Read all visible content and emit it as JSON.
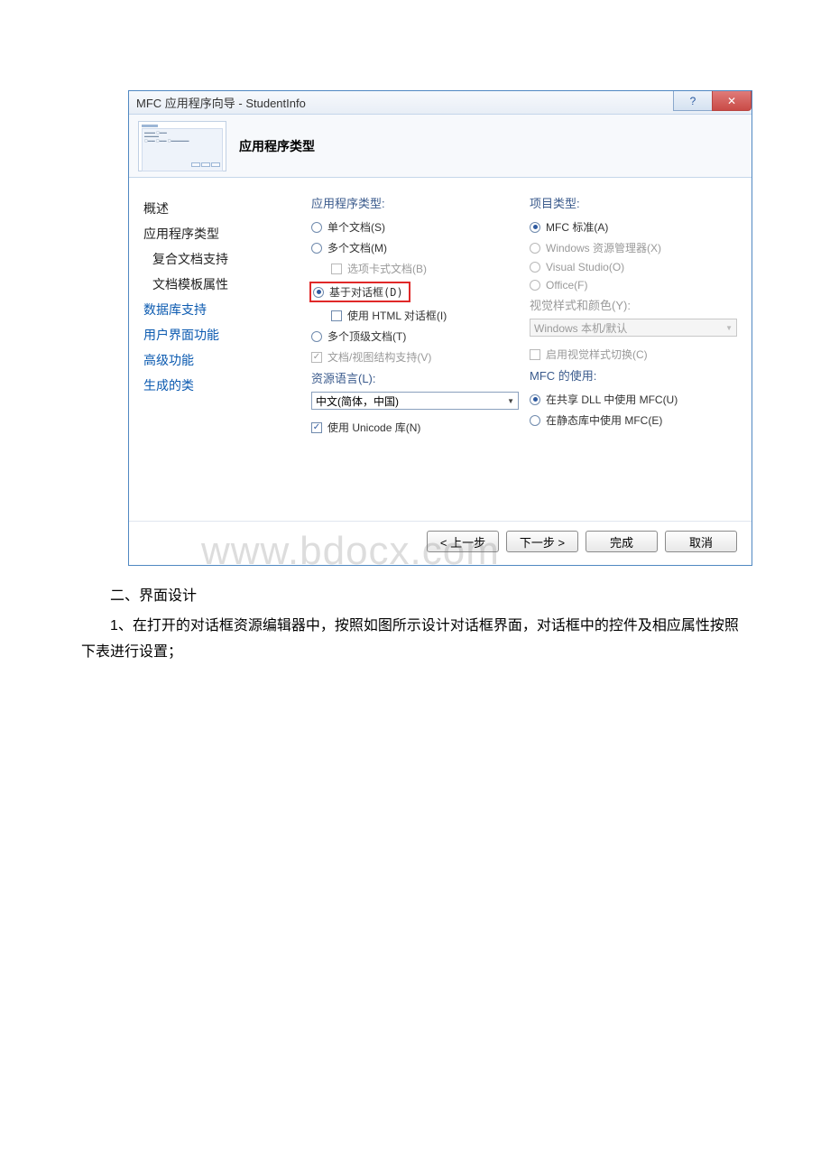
{
  "window": {
    "title": "MFC 应用程序向导 - StudentInfo",
    "help_icon": "?",
    "close_icon": "✕"
  },
  "header": {
    "title": "应用程序类型"
  },
  "sidebar": {
    "items": [
      {
        "label": "概述",
        "link": false,
        "indent": false
      },
      {
        "label": "应用程序类型",
        "link": false,
        "indent": false
      },
      {
        "label": "复合文档支持",
        "link": false,
        "indent": true
      },
      {
        "label": "文档模板属性",
        "link": false,
        "indent": true
      },
      {
        "label": "数据库支持",
        "link": true,
        "indent": false
      },
      {
        "label": "用户界面功能",
        "link": true,
        "indent": false
      },
      {
        "label": "高级功能",
        "link": true,
        "indent": false
      },
      {
        "label": "生成的类",
        "link": true,
        "indent": false
      }
    ]
  },
  "left_col": {
    "app_type_label": "应用程序类型:",
    "single_doc": "单个文档(S)",
    "multi_doc": "多个文档(M)",
    "tabbed_doc": "选项卡式文档(B)",
    "dialog_based": "基于对话框(D)",
    "use_html": "使用 HTML 对话框(I)",
    "top_level": "多个顶级文档(T)",
    "doc_view": "文档/视图结构支持(V)",
    "res_lang_label": "资源语言(L):",
    "res_lang_value": "中文(简体，中国)",
    "unicode": "使用 Unicode 库(N)"
  },
  "right_col": {
    "proj_type_label": "项目类型:",
    "mfc_std": "MFC 标准(A)",
    "win_explorer": "Windows 资源管理器(X)",
    "visual_studio": "Visual Studio(O)",
    "office": "Office(F)",
    "style_label": "视觉样式和颜色(Y):",
    "style_value": "Windows 本机/默认",
    "enable_style_switch": "启用视觉样式切换(C)",
    "mfc_use_label": "MFC 的使用:",
    "shared_dll": "在共享 DLL 中使用 MFC(U)",
    "static_lib": "在静态库中使用 MFC(E)"
  },
  "footer": {
    "back": "< 上一步",
    "next": "下一步 >",
    "finish": "完成",
    "cancel": "取消"
  },
  "watermark": "www.bdocx.com",
  "document": {
    "heading": "二、界面设计",
    "para": "1、在打开的对话框资源编辑器中，按照如图所示设计对话框界面，对话框中的控件及相应属性按照下表进行设置；"
  }
}
